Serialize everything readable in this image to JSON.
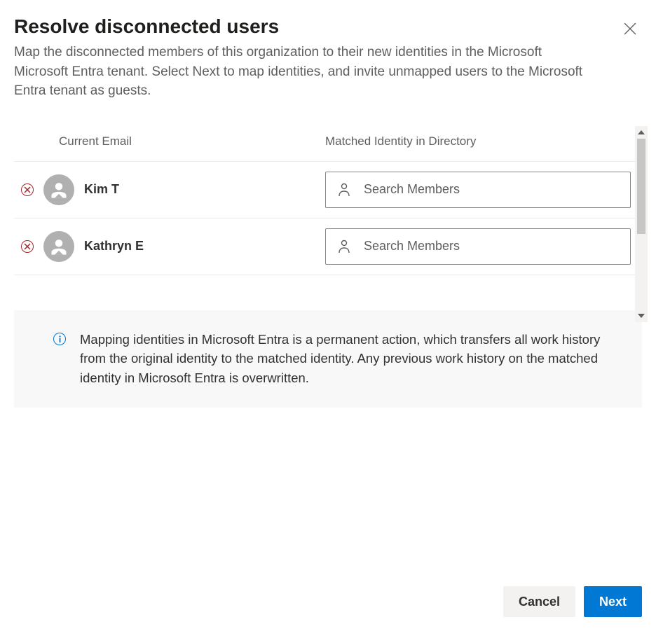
{
  "dialog": {
    "title": "Resolve disconnected users",
    "subtitle": "Map the disconnected members of this organization to their new identities in the Microsoft Microsoft Entra tenant. Select Next to map identities, and invite unmapped users to the Microsoft Entra tenant as guests."
  },
  "table": {
    "headers": {
      "email": "Current Email",
      "identity": "Matched Identity in Directory"
    },
    "rows": [
      {
        "name": "Kim T",
        "search_placeholder": "Search Members"
      },
      {
        "name": "Kathryn E",
        "search_placeholder": "Search Members"
      }
    ]
  },
  "info": {
    "message": "Mapping identities in Microsoft Entra is a permanent action, which transfers all work history from the original identity to the matched identity. Any previous work history on the matched identity in Microsoft Entra is overwritten."
  },
  "footer": {
    "cancel": "Cancel",
    "next": "Next"
  }
}
